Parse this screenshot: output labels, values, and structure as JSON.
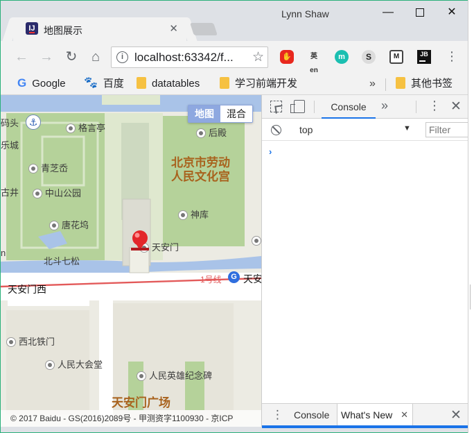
{
  "browser": {
    "tab_title": "地图展示",
    "tab_favicon": "IJ",
    "profile_name": "Lynn Shaw",
    "url": "localhost:63342/f...",
    "extensions": [
      {
        "name": "ublock-icon",
        "glyph": "✋"
      },
      {
        "name": "translate-icon",
        "glyph": "英en"
      },
      {
        "name": "mercury-icon",
        "glyph": "m"
      },
      {
        "name": "s-extension-icon",
        "glyph": "S"
      },
      {
        "name": "m-extension-icon",
        "glyph": "M"
      },
      {
        "name": "jetbrains-icon",
        "glyph": "JB"
      }
    ]
  },
  "bookmarks": {
    "google": "Google",
    "baidu": "百度",
    "datatables": "datatables",
    "learn": "学习前端开发",
    "more": "»",
    "other": "其他书签"
  },
  "map": {
    "type_control": {
      "map": "地图",
      "hybrid": "混合"
    },
    "pois": {
      "gechangting": "格言亭",
      "qingzhiduo": "青芝岙",
      "zhongshan_park": "中山公园",
      "tanghuawu": "唐花坞",
      "houdian": "后殿",
      "shenku": "神库",
      "tiananmen": "天安门",
      "xidan_street": "西北铁门",
      "great_hall": "人民大会堂",
      "monument": "人民英雄纪念碑"
    },
    "edge_labels": {
      "matou": "码头",
      "lecheng": "乐城",
      "gujing": "古井",
      "n": "n",
      "beidou_qisong": "北斗七松"
    },
    "big_labels": {
      "workers_palace": "北京市劳动\n人民文化宫",
      "square": "天安门广场"
    },
    "roads": {
      "tiananmen_west": "天安门西",
      "tiananmen_east": "天安",
      "line1": "1号线"
    },
    "subway_glyph": "G",
    "copyright": "© 2017 Baidu - GS(2016)2089号 - 甲测资字1100930 - 京ICP"
  },
  "devtools": {
    "console_tab": "Console",
    "more_tabs": "»",
    "context": "top",
    "filter_placeholder": "Filter",
    "prompt": "›",
    "drawer_console": "Console",
    "drawer_whats_new": "What's New"
  },
  "colors": {
    "window_border": "#2ab07a",
    "map_green": "#b5d29a",
    "map_water": "#a9c3e8",
    "subway_red": "#e35a5a",
    "marker_red": "#e3262a",
    "devtools_accent": "#1a73e8"
  }
}
